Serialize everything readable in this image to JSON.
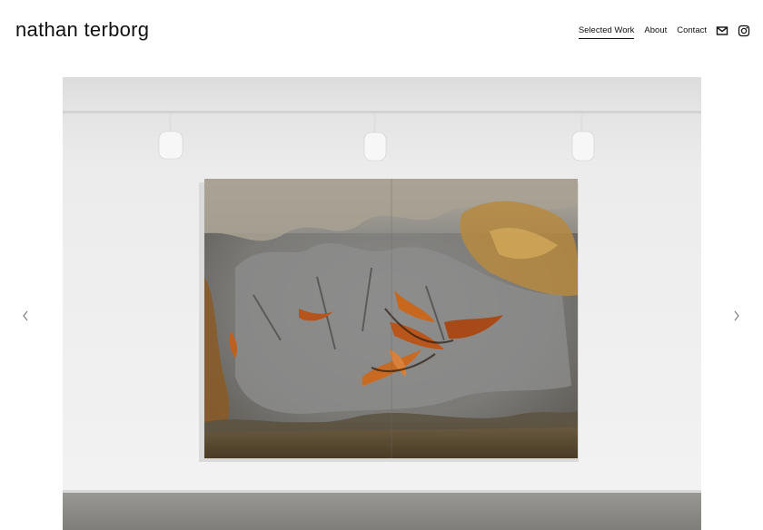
{
  "site": {
    "title": "nathan terborg"
  },
  "nav": {
    "items": [
      {
        "label": "Selected Work",
        "active": true
      },
      {
        "label": "About",
        "active": false
      },
      {
        "label": "Contact",
        "active": false
      }
    ],
    "icons": [
      "mail-icon",
      "instagram-icon"
    ]
  },
  "slideshow": {
    "prev_icon": "chevron-left-icon",
    "next_icon": "chevron-right-icon"
  },
  "colors": {
    "text": "#111111",
    "background": "#ffffff",
    "wall": "#ebebeb",
    "floor": "#8c8a87"
  }
}
